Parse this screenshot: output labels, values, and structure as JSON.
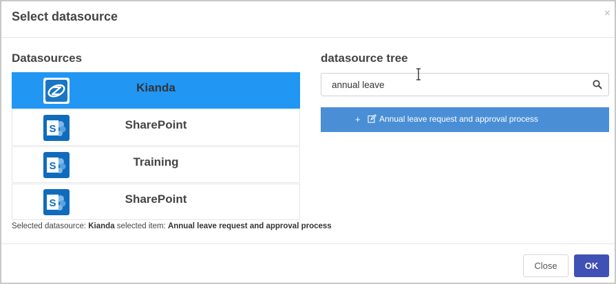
{
  "dialog": {
    "title": "Select datasource",
    "close_glyph": "×"
  },
  "datasources": {
    "heading": "Datasources",
    "items": [
      {
        "label": "Kianda",
        "icon": "kianda-logo-icon",
        "selected": true
      },
      {
        "label": "SharePoint",
        "icon": "sharepoint-icon",
        "selected": false
      },
      {
        "label": "Training",
        "icon": "sharepoint-icon",
        "selected": false
      },
      {
        "label": "SharePoint",
        "icon": "sharepoint-icon",
        "selected": false
      }
    ]
  },
  "selection_info": {
    "ds_prefix": "Selected datasource:",
    "ds_value": "Kianda",
    "item_prefix": "selected item:",
    "item_value": "Annual leave request and approval process"
  },
  "tree": {
    "heading": "datasource tree",
    "search_value": "annual leave",
    "search_icon": "search-icon",
    "results": [
      {
        "expand_glyph": "+",
        "icon": "edit-icon",
        "label": "Annual leave request and approval process"
      }
    ]
  },
  "footer": {
    "close_label": "Close",
    "ok_label": "OK"
  },
  "colors": {
    "selected_item_bg": "#2196f3",
    "tree_item_bg": "#4a8fd6",
    "ok_button_bg": "#3f51b5",
    "sharepoint_blue": "#0f6cbd",
    "kianda_blue": "#1a75c2"
  }
}
